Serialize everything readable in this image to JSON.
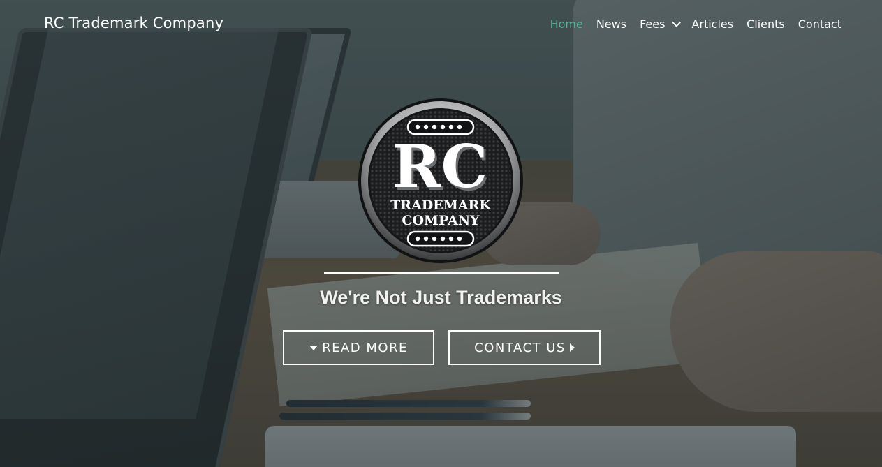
{
  "brand": {
    "name": "RC Trademark Company"
  },
  "nav": {
    "items": [
      {
        "label": "Home",
        "active": true
      },
      {
        "label": "News"
      },
      {
        "label": "Fees",
        "dropdown": true
      },
      {
        "label": "Articles"
      },
      {
        "label": "Clients"
      },
      {
        "label": "Contact"
      }
    ],
    "active_color": "#4fb89a"
  },
  "logo": {
    "big_text": "RC",
    "line1": "TRADEMARK",
    "line2": "COMPANY",
    "icon": "rc-trademark-company-logo"
  },
  "hero": {
    "tagline": "We're Not Just Trademarks",
    "read_more_label": "READ MORE",
    "contact_label": "CONTACT US"
  }
}
